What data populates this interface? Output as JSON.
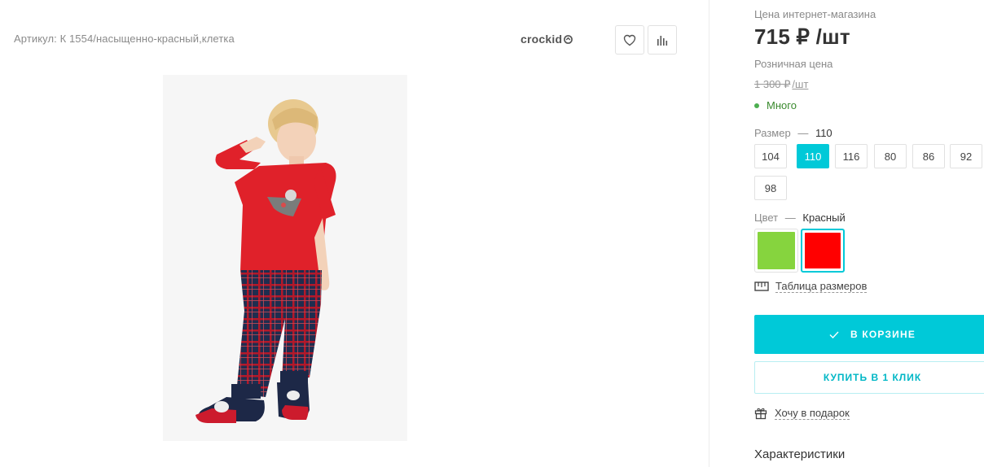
{
  "product": {
    "article": "Артикул: К 1554/насыщенно-красный,клетка",
    "brand": "crockid"
  },
  "pricing": {
    "online_label": "Цена интернет-магазина",
    "online_price": "715 ₽ /шт",
    "retail_label": "Розничная цена",
    "retail_price": "1 300 ₽",
    "retail_unit": "/шт",
    "stock": "Много"
  },
  "size_option": {
    "label": "Размер",
    "dash": "—",
    "selected": "110",
    "sizes": [
      "104",
      "110",
      "116",
      "80",
      "86",
      "92",
      "98"
    ]
  },
  "color_option": {
    "label": "Цвет",
    "dash": "—",
    "selected": "Красный",
    "swatches": [
      "#86d43e",
      "#ff0000"
    ]
  },
  "links": {
    "size_table": "Таблица размеров",
    "gift": "Хочу в подарок"
  },
  "actions": {
    "in_cart": "В КОРЗИНЕ",
    "one_click": "КУПИТЬ В 1 КЛИК"
  },
  "section": {
    "characteristics": "Характеристики"
  },
  "colors": {
    "accent": "#00c9d8",
    "stock_dot": "#4caf50"
  }
}
